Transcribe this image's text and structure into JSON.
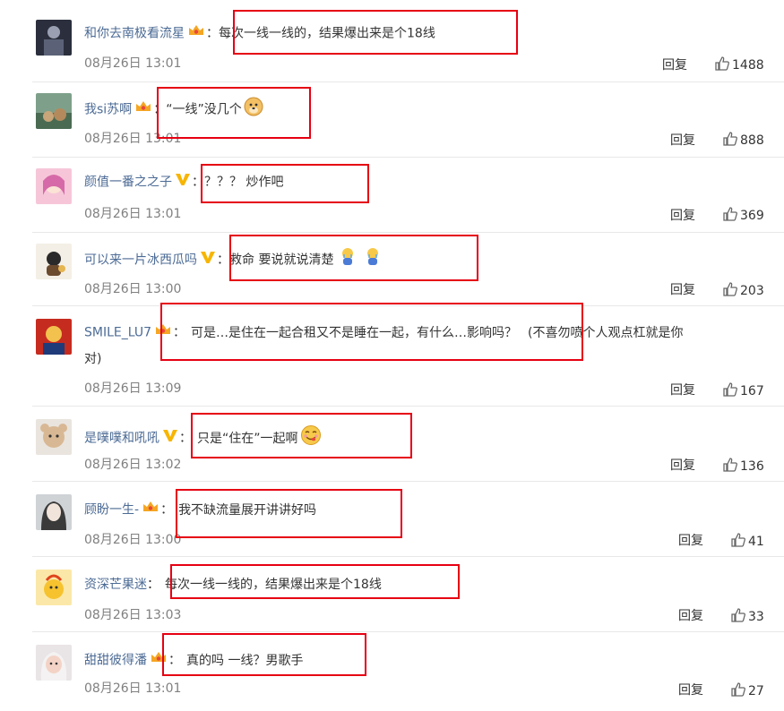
{
  "comments": [
    {
      "username": "和你去南极看流星",
      "badge": "crown",
      "content": "每次一线一线的，结果爆出来是个18线",
      "timestamp": "08月26日 13:01",
      "reply": "回复",
      "likes": "1488"
    },
    {
      "username": "我si苏啊",
      "badge": "crown",
      "content": "“一线”没几个",
      "emoji": "doge",
      "timestamp": "08月26日 13:01",
      "reply": "回复",
      "likes": "888"
    },
    {
      "username": "颜值一番之之子",
      "badge": "v",
      "content": "？？？ 炒作吧",
      "timestamp": "08月26日 13:01",
      "reply": "回复",
      "likes": "369"
    },
    {
      "username": "可以来一片冰西瓜吗",
      "badge": "v",
      "content": "救命 要说就说清楚",
      "emoji": "crying-figure",
      "timestamp": "08月26日 13:00",
      "reply": "回复",
      "likes": "203"
    },
    {
      "username": "SMILE_LU7",
      "badge": "crown",
      "content": "可是…是住在一起合租又不是睡在一起，有什么…影响吗？",
      "content_extra": "(不喜勿喷个人观点杠就是你",
      "content_wrap": "对)",
      "timestamp": "08月26日 13:09",
      "reply": "回复",
      "likes": "167"
    },
    {
      "username": "是噗噗和吼吼",
      "badge": "v",
      "content": "只是“住在”一起啊",
      "emoji": "yum-face",
      "timestamp": "08月26日 13:02",
      "reply": "回复",
      "likes": "136"
    },
    {
      "username": "顾盼一生-",
      "badge": "crown",
      "content": "我不缺流量展开讲讲好吗",
      "timestamp": "08月26日 13:00",
      "reply": "回复",
      "likes": "41"
    },
    {
      "username": "资深芒果迷",
      "badge": "",
      "content": "每次一线一线的，结果爆出来是个18线",
      "timestamp": "08月26日 13:03",
      "reply": "回复",
      "likes": "33"
    },
    {
      "username": "甜甜彼得潘",
      "badge": "crown",
      "content": "真的吗 一线？男歌手",
      "timestamp": "08月26日 13:01",
      "reply": "回复",
      "likes": "27"
    }
  ],
  "colors": {
    "username": "#4c6b95",
    "highlight": "#e60012",
    "timestamp": "#808080",
    "crown": "#f5a623",
    "vbadge": "#f7b500"
  }
}
